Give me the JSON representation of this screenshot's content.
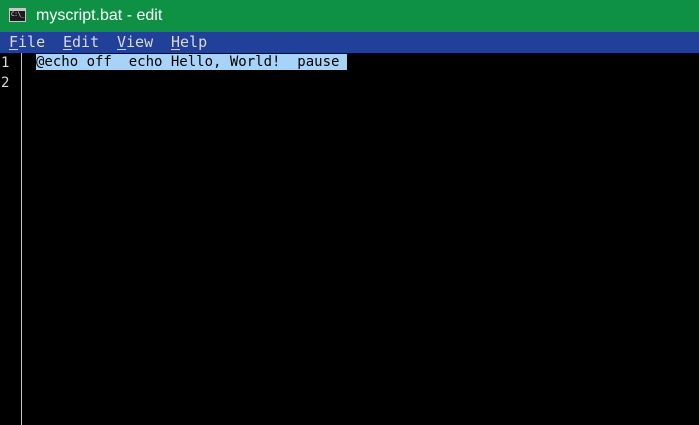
{
  "window": {
    "title": "myscript.bat - edit",
    "icon": "command-prompt-icon",
    "icon_text": "C:\\_"
  },
  "menu": {
    "items": [
      {
        "label": "File",
        "hotkey": "F",
        "rest": "ile"
      },
      {
        "label": "Edit",
        "hotkey": "E",
        "rest": "dit"
      },
      {
        "label": "View",
        "hotkey": "V",
        "rest": "iew"
      },
      {
        "label": "Help",
        "hotkey": "H",
        "rest": "elp"
      }
    ]
  },
  "editor": {
    "line_numbers": [
      "1",
      "2"
    ],
    "lines": [
      "@echo off  echo Hello, World!  pause",
      ""
    ],
    "selected_line": 1
  },
  "colors": {
    "titlebar": "#0f9145",
    "menubar": "#21409a",
    "editor_bg": "#000000",
    "selection": "#a9d2f7",
    "gutter": "#c8c8c8"
  }
}
